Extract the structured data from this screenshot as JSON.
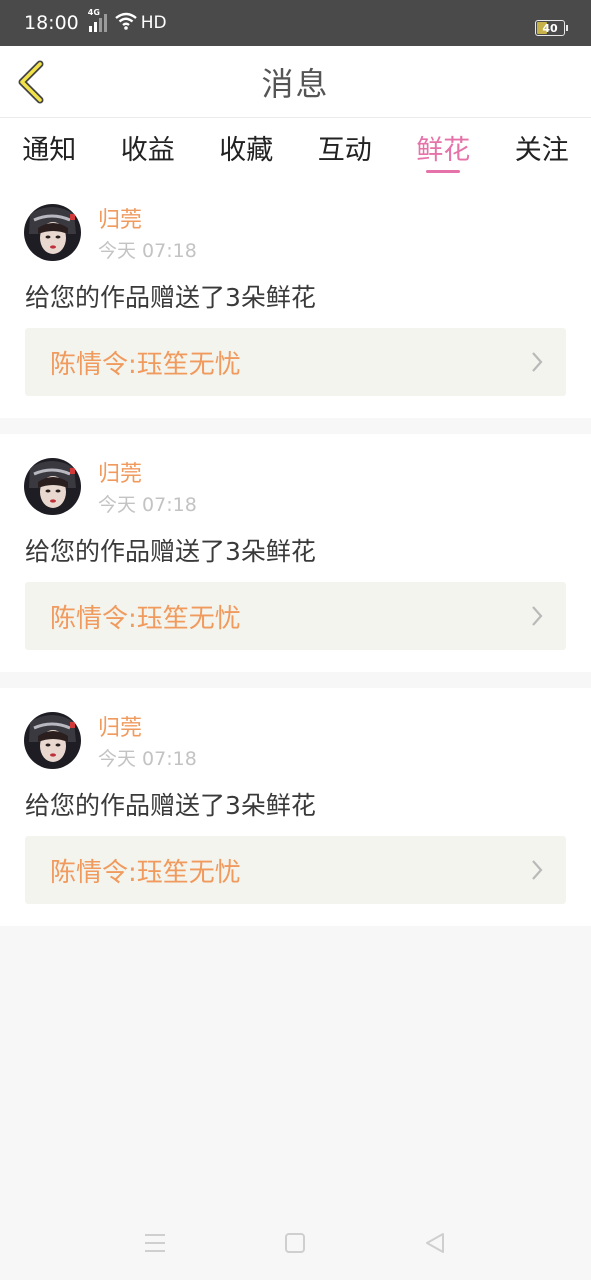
{
  "status": {
    "time": "18:00",
    "network": "4G",
    "hd": "HD",
    "battery": "40"
  },
  "header": {
    "title": "消息"
  },
  "tabs": [
    {
      "label": "通知",
      "active": false
    },
    {
      "label": "收益",
      "active": false
    },
    {
      "label": "收藏",
      "active": false
    },
    {
      "label": "互动",
      "active": false
    },
    {
      "label": "鲜花",
      "active": true
    },
    {
      "label": "关注",
      "active": false
    }
  ],
  "messages": [
    {
      "user": "归莞",
      "time": "今天 07:18",
      "text": "给您的作品赠送了3朵鲜花",
      "work": "陈情令:珏笙无忧"
    },
    {
      "user": "归莞",
      "time": "今天 07:18",
      "text": "给您的作品赠送了3朵鲜花",
      "work": "陈情令:珏笙无忧"
    },
    {
      "user": "归莞",
      "time": "今天 07:18",
      "text": "给您的作品赠送了3朵鲜花",
      "work": "陈情令:珏笙无忧"
    }
  ],
  "colors": {
    "accent_tab": "#e572a8",
    "username": "#f09a5e",
    "work_bg": "#f4f4ee"
  },
  "icons": {
    "back": "chevron-left-icon",
    "menu": "menu-icon",
    "home": "square-home-icon",
    "nav_back": "triangle-back-icon"
  }
}
